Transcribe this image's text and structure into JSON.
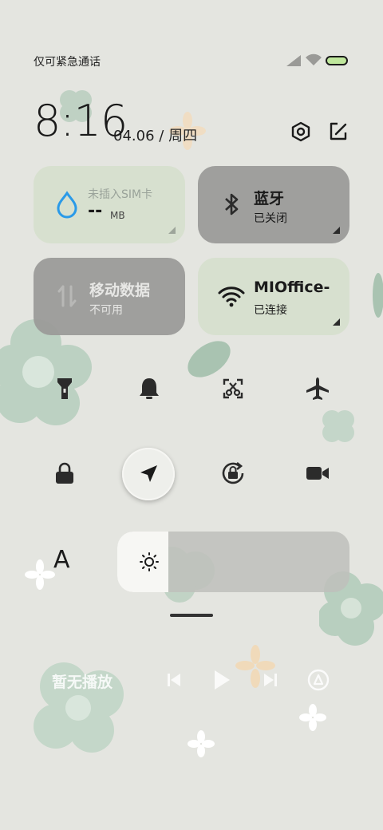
{
  "status_bar": {
    "carrier_text": "仅可紧急通话",
    "battery_color": "#bfe79c"
  },
  "header": {
    "time": "8:16",
    "date": "04.06",
    "separator": "/",
    "weekday": "周四",
    "icons": [
      "settings-icon",
      "edit-icon"
    ]
  },
  "tiles": {
    "data_usage": {
      "title": "未插入SIM卡",
      "value": "--",
      "unit": "MB"
    },
    "bluetooth": {
      "title": "蓝牙",
      "status": "已关闭"
    },
    "mobile_data": {
      "title": "移动数据",
      "status": "不可用"
    },
    "wifi": {
      "title": "MIOffice-",
      "status": "已连接"
    }
  },
  "toggles": {
    "row1": [
      "flashlight-icon",
      "bell-icon",
      "screenshot-icon",
      "airplane-icon"
    ],
    "row2": [
      "lock-icon",
      "location-icon",
      "rotation-lock-icon",
      "video-icon"
    ]
  },
  "brightness": {
    "auto_label": "A",
    "level_fraction": 0.22
  },
  "media": {
    "title": "暂无播放",
    "controls": [
      "previous-icon",
      "play-icon",
      "next-icon",
      "cast-icon"
    ]
  },
  "colors": {
    "tile_light": "#d6dfce",
    "tile_dark": "#9e9e9c",
    "accent_blue": "#2a9ae8",
    "background": "#e4e5e0"
  }
}
